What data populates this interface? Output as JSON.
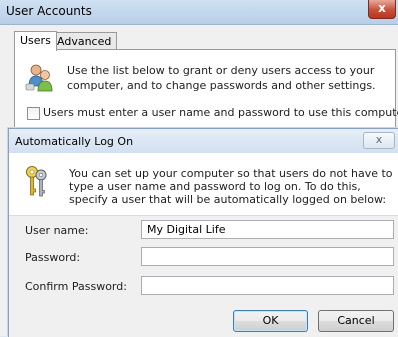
{
  "background_window": {
    "title": "User Accounts",
    "close_glyph": "x",
    "tabs": [
      {
        "label": "Users",
        "active": true
      },
      {
        "label": "Advanced",
        "active": false
      }
    ],
    "description": "Use the list below to grant or deny users access to your computer, and to change passwords and other settings.",
    "require_login_checkbox": {
      "label": "Users must enter a user name and password to use this computer.",
      "checked": false
    },
    "icon": "users-icon"
  },
  "dialog": {
    "title": "Automatically Log On",
    "close_glyph": "x",
    "icon": "keys-icon",
    "description": "You can set up your computer so that users do not have to type a user name and password to log on. To do this, specify a user that will be automatically logged on below:",
    "fields": {
      "user_name": {
        "label": "User name:",
        "value": "My Digital Life"
      },
      "password": {
        "label": "Password:",
        "value": ""
      },
      "confirm_password": {
        "label": "Confirm Password:",
        "value": ""
      }
    },
    "buttons": {
      "ok": "OK",
      "cancel": "Cancel"
    }
  },
  "colors": {
    "titlebar_active": "#b9cfe8",
    "close_button": "#c7503b",
    "dialog_bg": "#f0f0f0"
  }
}
